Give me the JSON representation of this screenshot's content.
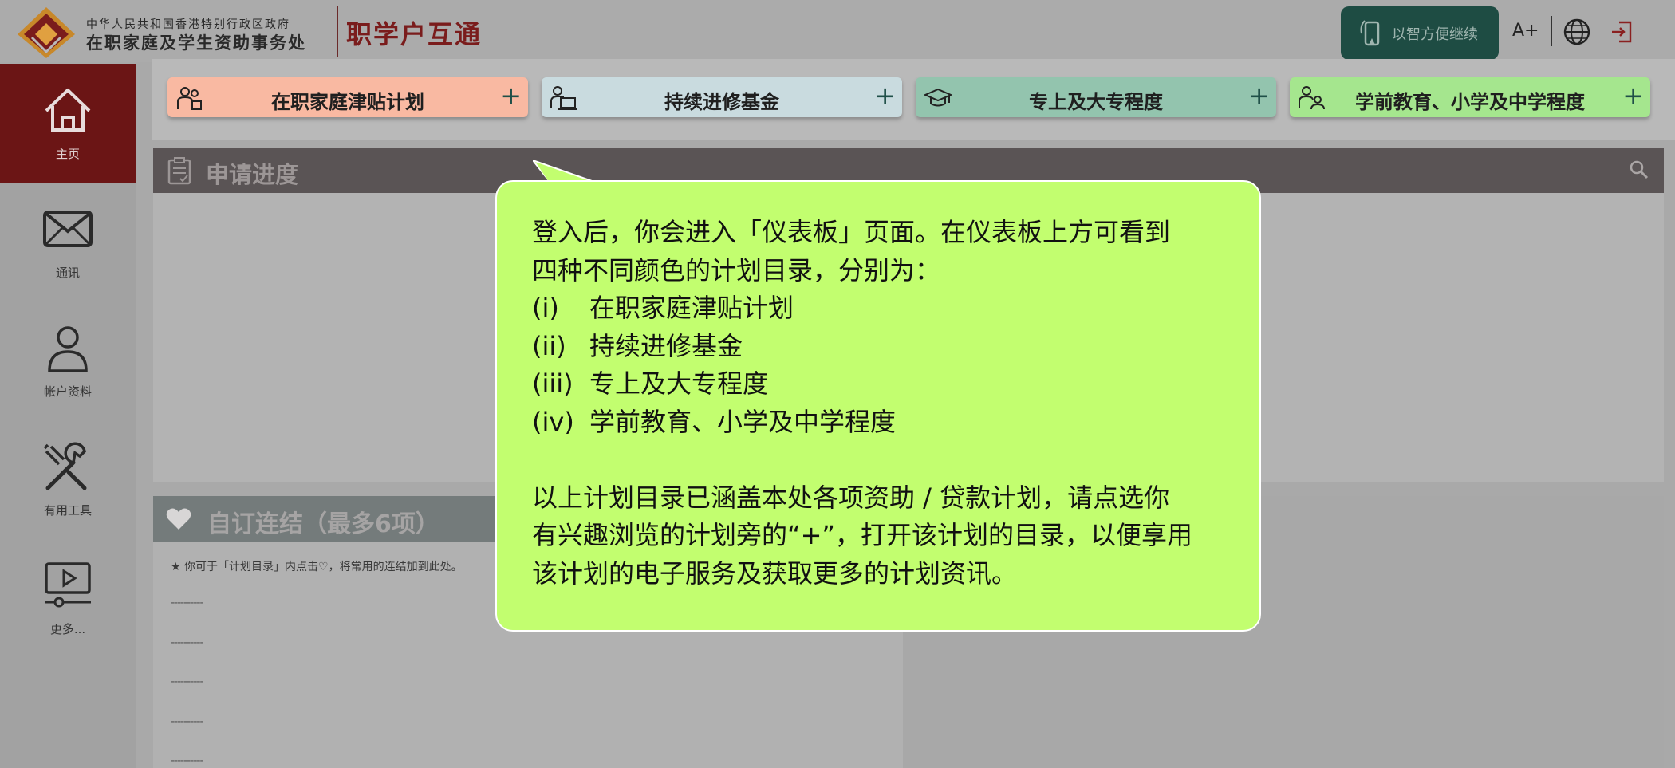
{
  "header": {
    "gov_line1": "中华人民共和国香港特别行政区政府",
    "gov_line2": "在职家庭及学生资助事务处",
    "brand": "职学户互通",
    "iam_label": "以智方便继续",
    "font_size_label": "A+"
  },
  "sidebar": {
    "items": [
      {
        "label": "主页",
        "icon": "home-icon",
        "active": true
      },
      {
        "label": "通讯",
        "icon": "mail-icon",
        "active": false
      },
      {
        "label": "帐户资料",
        "icon": "user-icon",
        "active": false
      },
      {
        "label": "有用工具",
        "icon": "tools-icon",
        "active": false
      },
      {
        "label": "更多...",
        "icon": "video-icon",
        "active": false
      }
    ]
  },
  "schemes": [
    {
      "label": "在职家庭津贴计划",
      "color": "#f9b9a2",
      "icon": "family-icon",
      "plus": "+"
    },
    {
      "label": "持续进修基金",
      "color": "#c9dbdf",
      "icon": "presenter-icon",
      "plus": "+"
    },
    {
      "label": "专上及大专程度",
      "color": "#93c4ae",
      "icon": "graduation-cap-icon",
      "plus": "+"
    },
    {
      "label": "学前教育、小学及中学程度",
      "color": "#a5e68e",
      "icon": "students-icon",
      "plus": "+"
    }
  ],
  "progress": {
    "title": "申请进度"
  },
  "links": {
    "title": "自订连结（最多6项）",
    "note": "你可于「计划目录」内点击♡，将常用的连结加到此处。",
    "placeholders": [
      "----------",
      "----------",
      "----------",
      "----------",
      "----------"
    ]
  },
  "callout": {
    "intro_line1": "登入后，你会进入「仪表板」页面。在仪表板上方可看到",
    "intro_line2": "四种不同颜色的计划目录，分别为：",
    "items": [
      {
        "num": "(i)",
        "text": "在职家庭津贴计划"
      },
      {
        "num": "(ii)",
        "text": "持续进修基金"
      },
      {
        "num": "(iii)",
        "text": "专上及大专程度"
      },
      {
        "num": "(iv)",
        "text": "学前教育、小学及中学程度"
      }
    ],
    "outro_line1": "以上计划目录已涵盖本处各项资助 / 贷款计划，请点选你",
    "outro_line2": "有兴趣浏览的计划旁的“+”，打开该计划的目录，以便享用",
    "outro_line3": "该计划的电子服务及获取更多的计划资讯。"
  },
  "colors": {
    "brand_red": "#7a1c1c",
    "sidebar_active": "#6b1515",
    "iam_green": "#1e4c43",
    "callout_bg": "#c2fe6f"
  }
}
